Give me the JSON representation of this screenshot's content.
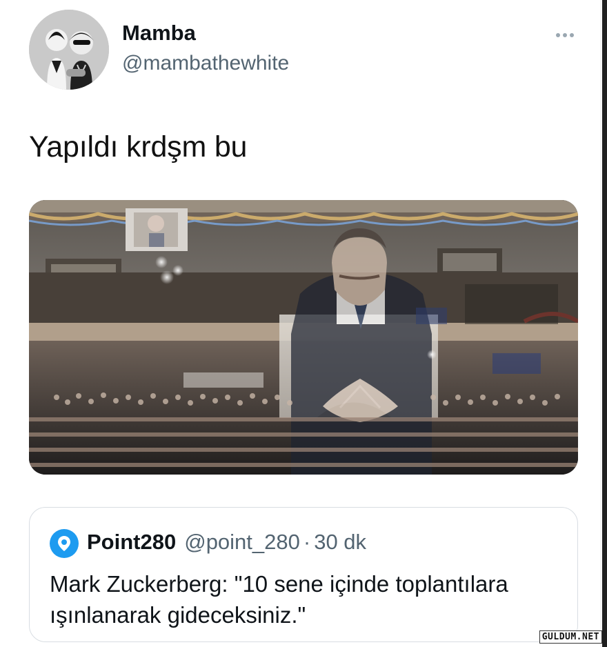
{
  "tweet": {
    "author_name": "Mamba",
    "author_handle": "@mambathewhite",
    "text": "Yapıldı krdşm bu",
    "more_icon": "more-horizontal-icon",
    "avatar_label": "profile photo",
    "image_alt": "hologram at rally"
  },
  "quote": {
    "author_name": "Point280",
    "author_handle": "@point_280",
    "separator": "·",
    "time": "30 dk",
    "text": "Mark Zuckerberg: \"10 sene içinde toplantılara ışınlanarak gideceksiniz.\"",
    "avatar_icon": "location-pin-icon"
  },
  "watermark": "GULDUM.NET",
  "colors": {
    "primary_text": "#0f1419",
    "secondary_text": "#536471",
    "border": "#d8dde2",
    "accent_blue": "#1d9bf0"
  }
}
